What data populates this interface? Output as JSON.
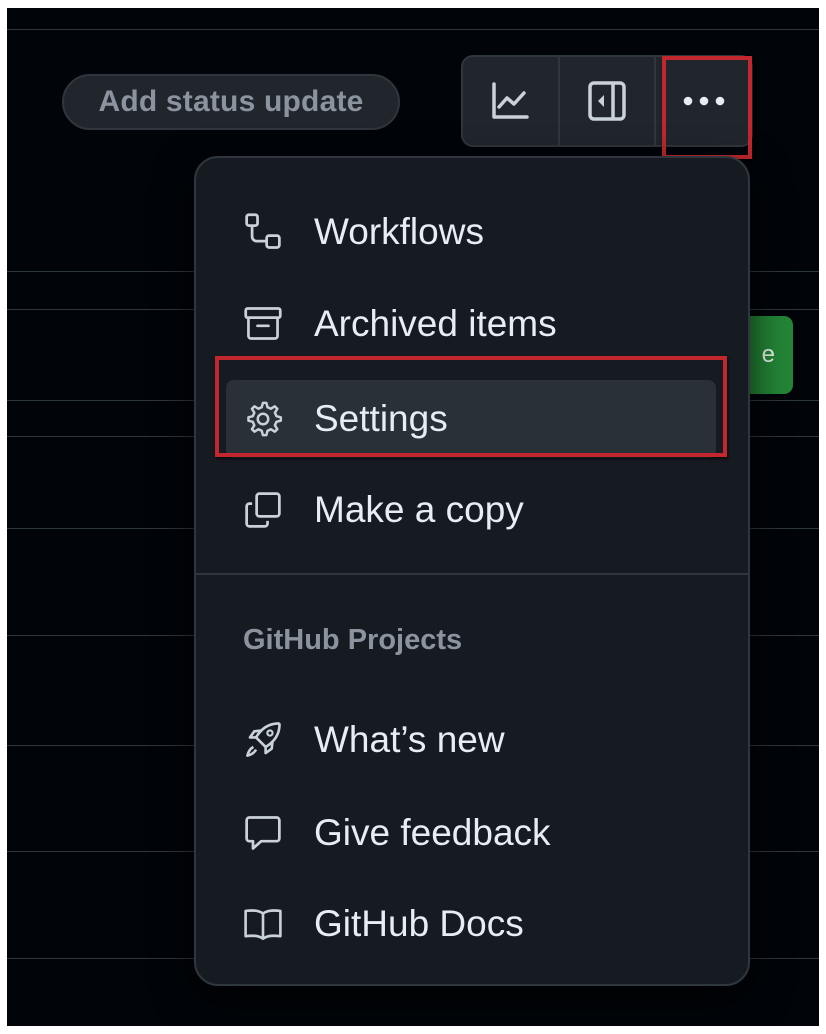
{
  "header": {
    "status_button": "Add status update"
  },
  "toolbar": {
    "buttons": [
      {
        "name": "insights",
        "icon": "graph-icon"
      },
      {
        "name": "side-panel",
        "icon": "sidebar-collapse-icon"
      },
      {
        "name": "more",
        "icon": "kebab-horizontal-icon"
      }
    ]
  },
  "background_button": {
    "label": "e",
    "color": "#238636"
  },
  "menu": {
    "items": [
      {
        "label": "Workflows",
        "icon": "workflow-icon"
      },
      {
        "label": "Archived items",
        "icon": "archive-icon"
      },
      {
        "label": "Settings",
        "icon": "gear-icon",
        "selected": true
      },
      {
        "label": "Make a copy",
        "icon": "copy-icon"
      }
    ],
    "group_title": "GitHub Projects",
    "group_items": [
      {
        "label": "What’s new",
        "icon": "rocket-icon"
      },
      {
        "label": "Give feedback",
        "icon": "comment-icon"
      },
      {
        "label": "GitHub Docs",
        "icon": "book-icon"
      }
    ]
  },
  "colors": {
    "background": "#010409",
    "menu_background": "#161b22",
    "border": "#30363d",
    "text": "#e6edf3",
    "muted_text": "#8b949e",
    "highlight_annotation": "#c1272d"
  }
}
